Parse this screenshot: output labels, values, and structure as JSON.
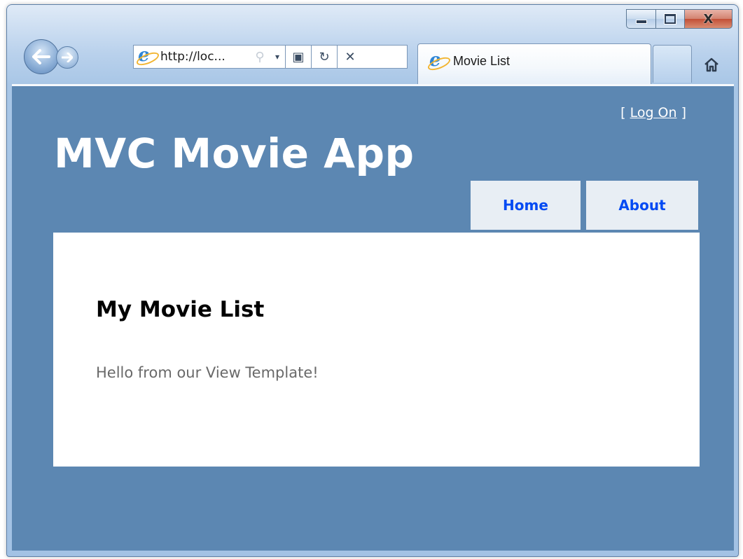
{
  "window": {
    "caption_buttons": {
      "minimize": "—",
      "maximize": "□",
      "close": "X"
    }
  },
  "toolbar": {
    "back_icon": "back-arrow-icon",
    "forward_icon": "forward-arrow-icon",
    "address": "http://loc...",
    "search_glyph": "⚲",
    "dropdown_glyph": "▾",
    "compat_glyph": "▣",
    "refresh_glyph": "↻",
    "stop_glyph": "✕",
    "home_glyph": "⌂"
  },
  "tab": {
    "title": "Movie List"
  },
  "page": {
    "login_prefix": "[ ",
    "login_link": "Log On",
    "login_suffix": " ]",
    "site_title": "MVC Movie App",
    "menu": [
      {
        "label": "Home"
      },
      {
        "label": "About"
      }
    ],
    "heading": "My Movie List",
    "body_text": "Hello from our View Template!"
  },
  "colors": {
    "page_background": "#5c87b2",
    "menu_link": "#034af3",
    "menu_background": "#e8eef4",
    "content_background": "#ffffff"
  }
}
